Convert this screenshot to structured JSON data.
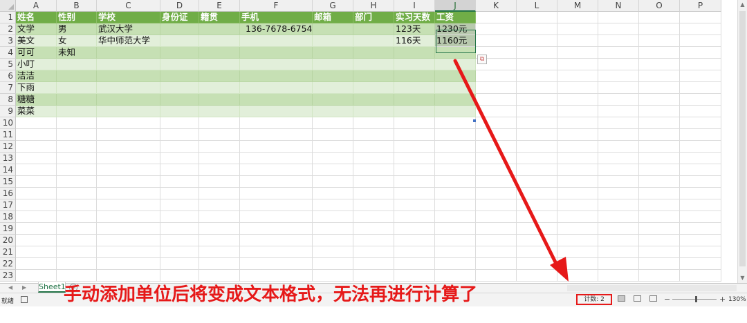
{
  "sheet": {
    "columns": [
      "A",
      "B",
      "C",
      "D",
      "E",
      "F",
      "G",
      "H",
      "I",
      "J",
      "K",
      "L",
      "M",
      "N",
      "O",
      "P"
    ],
    "selected_column": "J",
    "rows": [
      "1",
      "2",
      "3",
      "4",
      "5",
      "6",
      "7",
      "8",
      "9",
      "10",
      "11",
      "12",
      "13",
      "14",
      "15",
      "16",
      "17",
      "18",
      "19",
      "20",
      "21",
      "22",
      "23"
    ],
    "headers": [
      "姓名",
      "性别",
      "学校",
      "身份证",
      "籍贯",
      "手机",
      "邮箱",
      "部门",
      "实习天数",
      "工资"
    ],
    "data": [
      [
        "文学",
        "男",
        "武汉大学",
        "",
        "",
        "136-7678-6754",
        "",
        "",
        "123天",
        "1230元"
      ],
      [
        "美文",
        "女",
        "华中师范大学",
        "",
        "",
        "",
        "",
        "",
        "116天",
        "1160元"
      ],
      [
        "可可",
        "未知",
        "",
        "",
        "",
        "",
        "",
        "",
        "",
        ""
      ],
      [
        "小叮",
        "",
        "",
        "",
        "",
        "",
        "",
        "",
        "",
        ""
      ],
      [
        "洁洁",
        "",
        "",
        "",
        "",
        "",
        "",
        "",
        "",
        ""
      ],
      [
        "下雨",
        "",
        "",
        "",
        "",
        "",
        "",
        "",
        "",
        ""
      ],
      [
        "糖糖",
        "",
        "",
        "",
        "",
        "",
        "",
        "",
        "",
        ""
      ],
      [
        "菜菜",
        "",
        "",
        "",
        "",
        "",
        "",
        "",
        "",
        ""
      ]
    ]
  },
  "tabs": {
    "sheet_name": "Sheet1",
    "add_symbol": "+"
  },
  "status": {
    "ready": "就绪",
    "count": "计数: 2",
    "zoom_minus": "−",
    "zoom_plus": "+",
    "zoom": "130%"
  },
  "annotation": {
    "text": "手动添加单位后将变成文本格式，无法再进行计算了",
    "color": "#e61919"
  },
  "colors": {
    "header_green": "#70ad47",
    "band_dark": "#c6e0b4",
    "band_light": "#e2efda",
    "accent": "#217346"
  }
}
